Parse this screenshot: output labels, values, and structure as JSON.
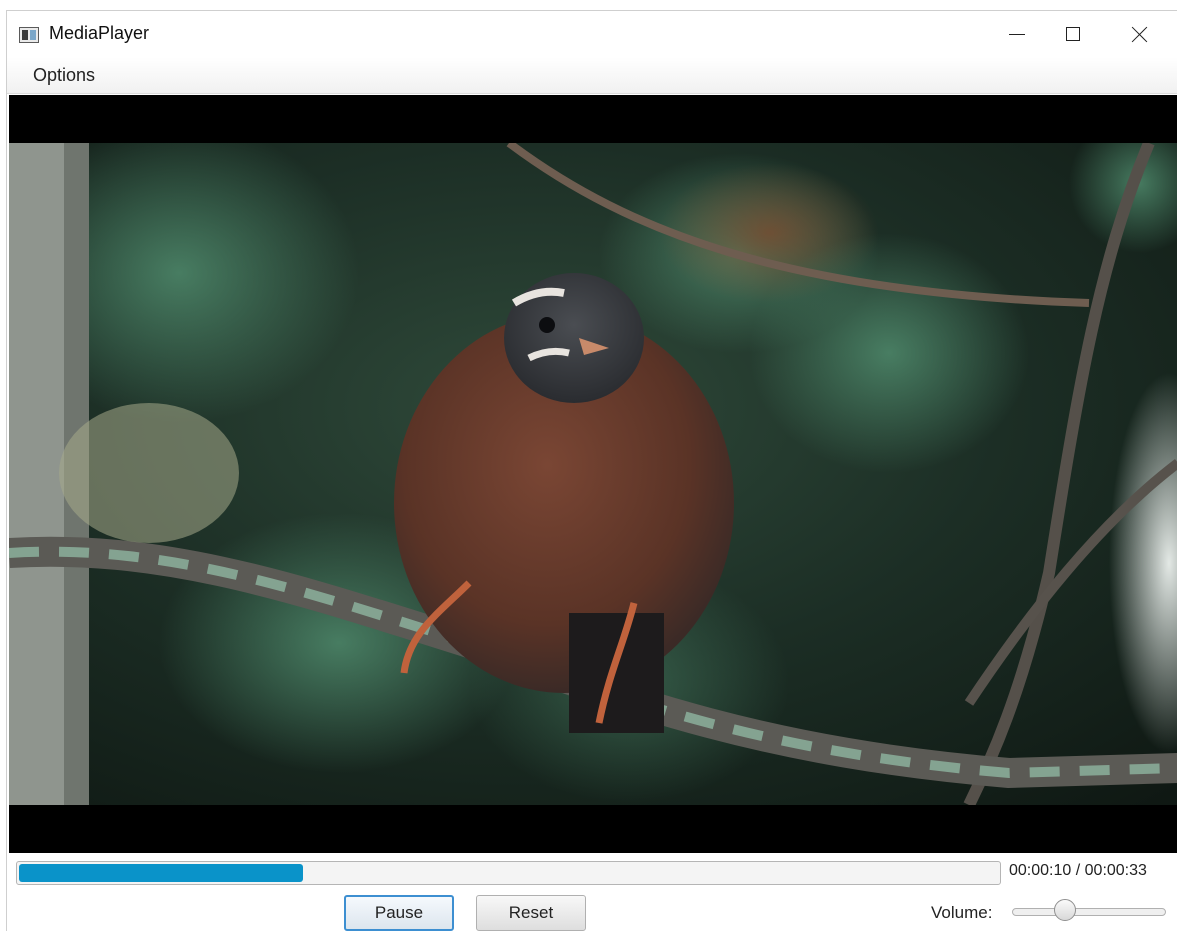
{
  "window": {
    "title": "MediaPlayer",
    "icon": "media-app-icon",
    "controls": {
      "minimize": "minimize-icon",
      "maximize": "maximize-icon",
      "close": "close-icon"
    }
  },
  "menu": {
    "items": [
      {
        "label": "Options"
      }
    ]
  },
  "playback": {
    "current_time": "00:00:10",
    "total_time": "00:00:33",
    "separator": "/",
    "progress_fraction": 0.29
  },
  "controls": {
    "pause_label": "Pause",
    "reset_label": "Reset",
    "volume_label": "Volume:",
    "volume_fraction": 0.32
  },
  "colors": {
    "progress_fill": "#0a93c9",
    "focus_border": "#3d8fd1",
    "letterbox": "#000000"
  }
}
